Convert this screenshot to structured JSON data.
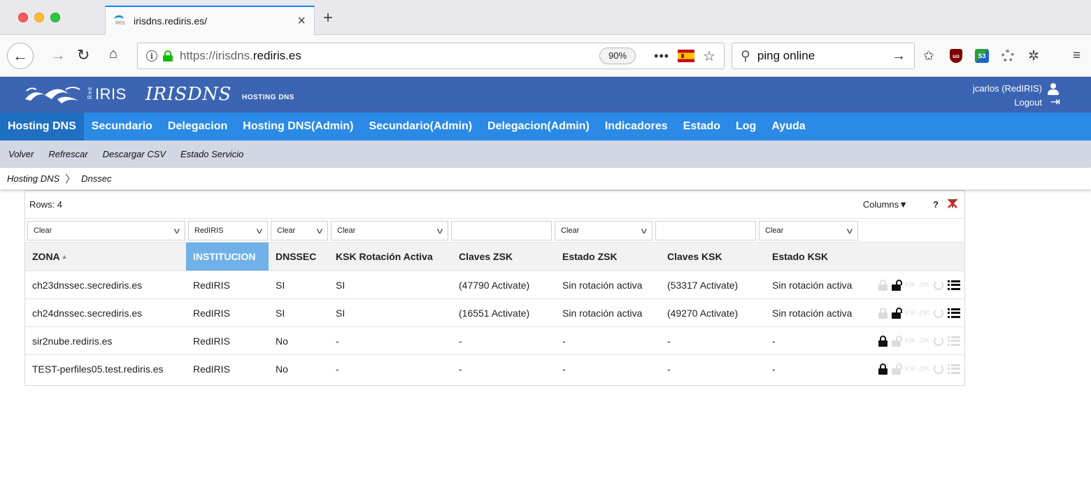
{
  "browser": {
    "tab_title": "irisdns.rediris.es/",
    "tab_favicon_label": "IRIS",
    "url_prefix": "https://irisdns.",
    "url_domain": "rediris.es",
    "zoom": "90%",
    "search_text": "ping online"
  },
  "header": {
    "logo_red": "Red",
    "logo_iris": "IRIS",
    "title": "IRISDNS",
    "subtitle": "HOSTING DNS",
    "user": "jcarlos (RedIRIS)",
    "logout": "Logout",
    "brand_color": "#3b64b3"
  },
  "main_nav": [
    {
      "label": "Hosting DNS",
      "active": true
    },
    {
      "label": "Secundario"
    },
    {
      "label": "Delegacion"
    },
    {
      "label": "Hosting DNS(Admin)"
    },
    {
      "label": "Secundario(Admin)"
    },
    {
      "label": "Delegacion(Admin)"
    },
    {
      "label": "Indicadores"
    },
    {
      "label": "Estado"
    },
    {
      "label": "Log"
    },
    {
      "label": "Ayuda"
    }
  ],
  "sub_nav": [
    "Volver",
    "Refrescar",
    "Descargar CSV",
    "Estado Servicio"
  ],
  "breadcrumb": [
    "Hosting DNS",
    "Dnssec"
  ],
  "grid": {
    "rows_label": "Rows: 4",
    "columns_label": "Columns▼",
    "help_label": "?",
    "filters": [
      "Clear",
      "RedIRIS",
      "Clear",
      "Clear",
      "",
      "Clear",
      "",
      "Clear"
    ],
    "headers": [
      "ZONA",
      "INSTITUCION",
      "DNSSEC",
      "KSK Rotación Activa",
      "Claves ZSK",
      "Estado ZSK",
      "Claves KSK",
      "Estado KSK"
    ],
    "sorted_column": "INSTITUCION",
    "rows": [
      {
        "zona": "ch23dnssec.secrediris.es",
        "institucion": "RedIRIS",
        "dnssec": "SI",
        "ksk_rot": "SI",
        "claves_zsk": "(47790 Activate)",
        "estado_zsk": "Sin rotación activa",
        "claves_ksk": "(53317 Activate)",
        "estado_ksk": "Sin rotación activa",
        "enabled": true
      },
      {
        "zona": "ch24dnssec.secrediris.es",
        "institucion": "RedIRIS",
        "dnssec": "SI",
        "ksk_rot": "SI",
        "claves_zsk": "(16551 Activate)",
        "estado_zsk": "Sin rotación activa",
        "claves_ksk": "(49270 Activate)",
        "estado_ksk": "Sin rotación activa",
        "enabled": true
      },
      {
        "zona": "sir2nube.rediris.es",
        "institucion": "RedIRIS",
        "dnssec": "No",
        "ksk_rot": "-",
        "claves_zsk": "-",
        "estado_zsk": "-",
        "claves_ksk": "-",
        "estado_ksk": "-",
        "enabled": false
      },
      {
        "zona": "TEST-perfiles05.test.rediris.es",
        "institucion": "RedIRIS",
        "dnssec": "No",
        "ksk_rot": "-",
        "claves_zsk": "-",
        "estado_zsk": "-",
        "claves_ksk": "-",
        "estado_ksk": "-",
        "enabled": false
      }
    ],
    "action_labels": {
      "ksk1": "KSK",
      "ksk2": "ZSK"
    }
  }
}
